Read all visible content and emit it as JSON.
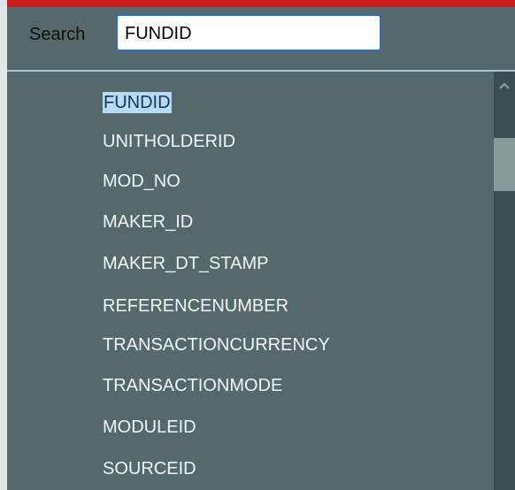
{
  "search": {
    "label": "Search",
    "value": "FUNDID"
  },
  "list": {
    "items": [
      "FUNDID",
      "UNITHOLDERID",
      "MOD_NO",
      "MAKER_ID",
      "MAKER_DT_STAMP",
      "REFERENCENUMBER",
      "TRANSACTIONCURRENCY",
      "TRANSACTIONMODE",
      "MODULEID",
      "SOURCEID"
    ],
    "selected": "FUNDID"
  },
  "colors": {
    "panel_bg": "#55696c",
    "top_bar": "#cc1d1d",
    "selection_bg": "#b6dcf5",
    "input_border": "#2f6fb8"
  },
  "icons": {
    "scroll_up": "chevron-up-icon"
  }
}
